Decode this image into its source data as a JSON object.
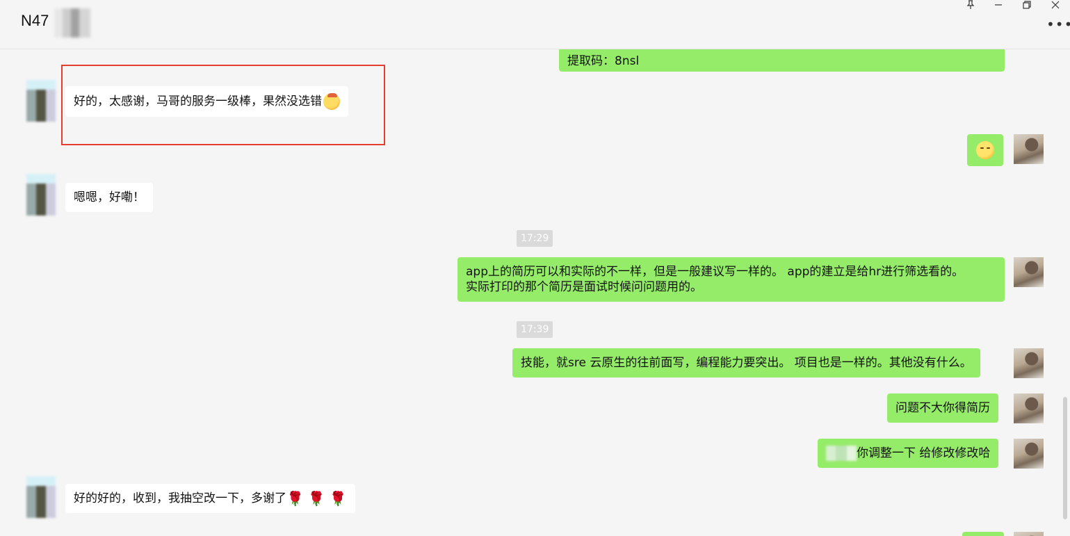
{
  "window": {
    "title": "N47",
    "pin_icon": "pin-icon",
    "minimize_icon": "minimize-icon",
    "restore_icon": "restore-icon",
    "close_icon": "close-icon",
    "more_icon": "more-icon"
  },
  "messages": [
    {
      "side": "out",
      "text": "提取码：8nsl"
    },
    {
      "side": "in",
      "text": "好的，太感谢，马哥的服务一级棒，果然没选错",
      "emoji": "shushing-face-emoji"
    },
    {
      "side": "out",
      "emoji": "smiling-face-emoji"
    },
    {
      "side": "in",
      "text": "嗯嗯，好嘞！"
    },
    {
      "type": "time",
      "text": "17:29"
    },
    {
      "side": "out",
      "lines": [
        "app上的简历可以和实际的不一样，但是一般建议写一样的。 app的建立是给hr进行筛选看的。",
        "实际打印的那个简历是面试时候问问题用的。"
      ]
    },
    {
      "type": "time",
      "text": "17:39"
    },
    {
      "side": "out",
      "text": "技能，就sre 云原生的往前面写，编程能力要突出。 项目也是一样的。其他没有什么。"
    },
    {
      "side": "out",
      "text": "问题不大你得简历"
    },
    {
      "side": "out",
      "text": "你调整一下 给修改修改哈"
    },
    {
      "side": "in",
      "text": "好的好的，收到，我抽空改一下，多谢了",
      "emoji": "rose-emoji"
    }
  ]
}
